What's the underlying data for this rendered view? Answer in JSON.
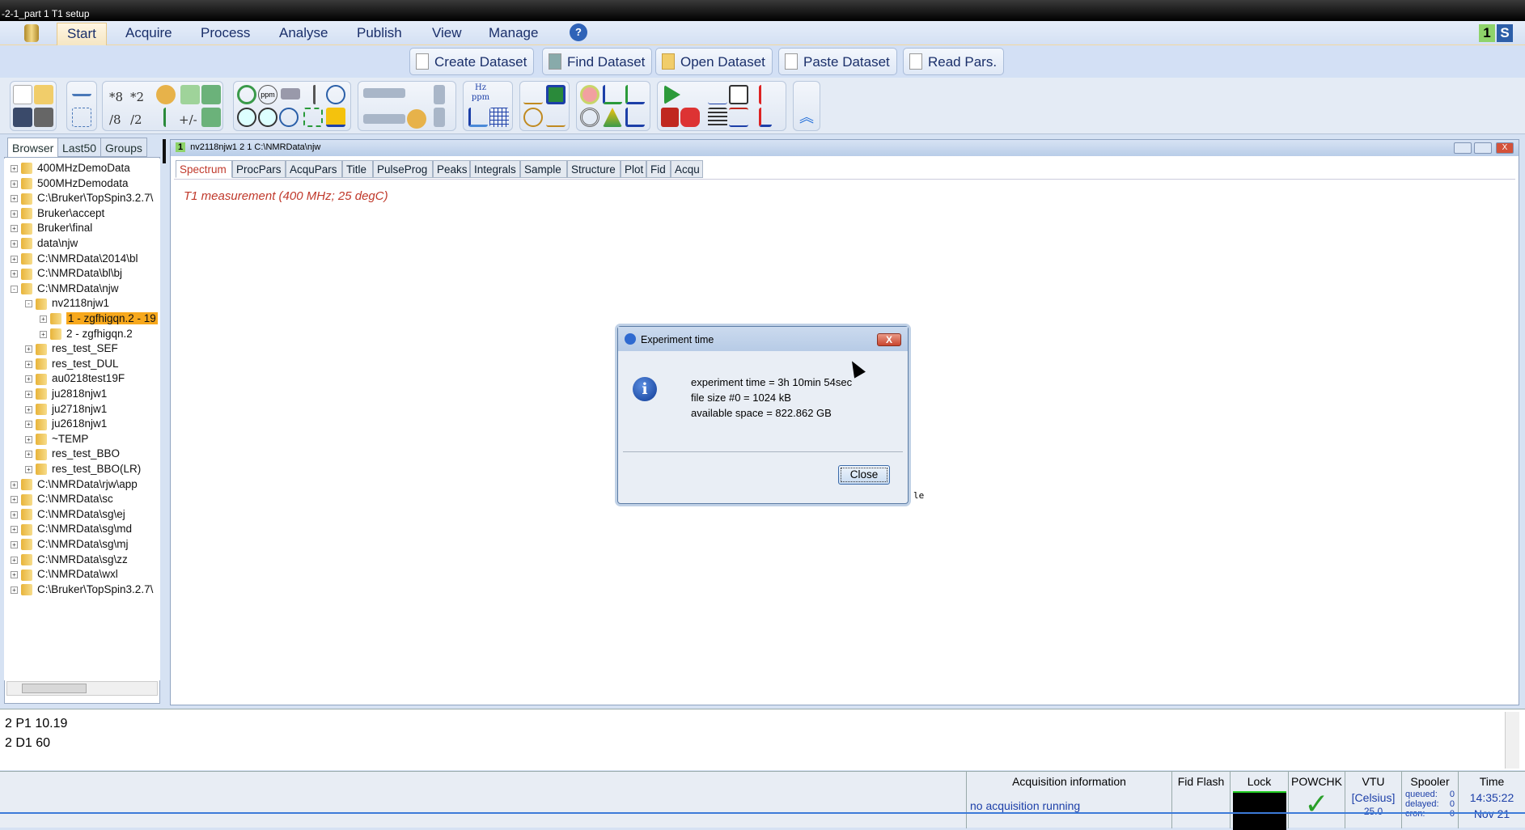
{
  "window": {
    "title": "-2-1_part 1 T1 setup"
  },
  "menu": {
    "items": [
      "Start",
      "Acquire",
      "Process",
      "Analyse",
      "Publish",
      "View",
      "Manage"
    ],
    "help": "?",
    "right_badges": [
      "1",
      "S"
    ]
  },
  "dataset_buttons": [
    "Create Dataset",
    "Find Dataset",
    "Open Dataset",
    "Paste Dataset",
    "Read Pars."
  ],
  "toolbar_labels": {
    "mul8": "*8",
    "mul2": "*2",
    "div8": "/8",
    "div2": "/2",
    "pm": "+/-",
    "ppm": "ppm",
    "hz": "Hz",
    "ppm2": "ppm"
  },
  "browser": {
    "tabs": [
      "Browser",
      "Last50",
      "Groups"
    ],
    "tree": [
      {
        "label": "400MHzDemoData",
        "level": 0,
        "exp": "+"
      },
      {
        "label": "500MHzDemodata",
        "level": 0,
        "exp": "+"
      },
      {
        "label": "C:\\Bruker\\TopSpin3.2.7\\",
        "level": 0,
        "exp": "+"
      },
      {
        "label": "Bruker\\accept",
        "level": 0,
        "exp": "+"
      },
      {
        "label": "Bruker\\final",
        "level": 0,
        "exp": "+"
      },
      {
        "label": "data\\njw",
        "level": 0,
        "exp": "+"
      },
      {
        "label": "C:\\NMRData\\2014\\bl",
        "level": 0,
        "exp": "+"
      },
      {
        "label": "C:\\NMRData\\bl\\bj",
        "level": 0,
        "exp": "+"
      },
      {
        "label": "C:\\NMRData\\njw",
        "level": 0,
        "exp": "-"
      },
      {
        "label": "nv2118njw1",
        "level": 1,
        "exp": "-"
      },
      {
        "label": "1 - zgfhigqn.2 - 19",
        "level": 2,
        "exp": "+",
        "selected": true
      },
      {
        "label": "2 - zgfhigqn.2",
        "level": 2,
        "exp": "+"
      },
      {
        "label": "res_test_SEF",
        "level": 1,
        "exp": "+"
      },
      {
        "label": "res_test_DUL",
        "level": 1,
        "exp": "+"
      },
      {
        "label": "au0218test19F",
        "level": 1,
        "exp": "+"
      },
      {
        "label": "ju2818njw1",
        "level": 1,
        "exp": "+"
      },
      {
        "label": "ju2718njw1",
        "level": 1,
        "exp": "+"
      },
      {
        "label": "ju2618njw1",
        "level": 1,
        "exp": "+"
      },
      {
        "label": "~TEMP",
        "level": 1,
        "exp": "+"
      },
      {
        "label": "res_test_BBO",
        "level": 1,
        "exp": "+"
      },
      {
        "label": "res_test_BBO(LR)",
        "level": 1,
        "exp": "+"
      },
      {
        "label": "C:\\NMRData\\rjw\\app",
        "level": 0,
        "exp": "+"
      },
      {
        "label": "C:\\NMRData\\sc",
        "level": 0,
        "exp": "+"
      },
      {
        "label": "C:\\NMRData\\sg\\ej",
        "level": 0,
        "exp": "+"
      },
      {
        "label": "C:\\NMRData\\sg\\md",
        "level": 0,
        "exp": "+"
      },
      {
        "label": "C:\\NMRData\\sg\\mj",
        "level": 0,
        "exp": "+"
      },
      {
        "label": "C:\\NMRData\\sg\\zz",
        "level": 0,
        "exp": "+"
      },
      {
        "label": "C:\\NMRData\\wxl",
        "level": 0,
        "exp": "+"
      },
      {
        "label": "C:\\Bruker\\TopSpin3.2.7\\",
        "level": 0,
        "exp": "+"
      }
    ]
  },
  "dataset_window": {
    "number": "1",
    "path": "nv2118njw1  2  1  C:\\NMRData\\njw",
    "tabs": [
      "Spectrum",
      "ProcPars",
      "AcquPars",
      "Title",
      "PulseProg",
      "Peaks",
      "Integrals",
      "Sample",
      "Structure",
      "Plot",
      "Fid",
      "Acqu"
    ],
    "spectrum_title": "T1 measurement (400 MHz; 25 degC)",
    "stray_text": "le"
  },
  "dialog": {
    "title": "Experiment time",
    "lines": [
      "experiment time = 3h 10min 54sec",
      "file size #0 = 1024 kB",
      "available space = 822.862 GB"
    ],
    "close_label": "Close",
    "x": "X"
  },
  "command_output": [
    "2 P1 10.19",
    "2 D1 60"
  ],
  "status": {
    "acq_header": "Acquisition information",
    "acq_value": "no acquisition running",
    "fid_flash": "Fid Flash",
    "lock": "Lock",
    "powchk": "POWCHK",
    "powchk_mark": "✓",
    "vtu": "VTU",
    "vtu_unit": "[Celsius]",
    "vtu_value": "25.0",
    "spooler": "Spooler",
    "queued_label": "queued:",
    "queued": "0",
    "delayed_label": "delayed:",
    "delayed": "0",
    "cron_label": "cron:",
    "cron": "0",
    "time_header": "Time",
    "time": "14:35:22",
    "date": "Nov 21"
  }
}
